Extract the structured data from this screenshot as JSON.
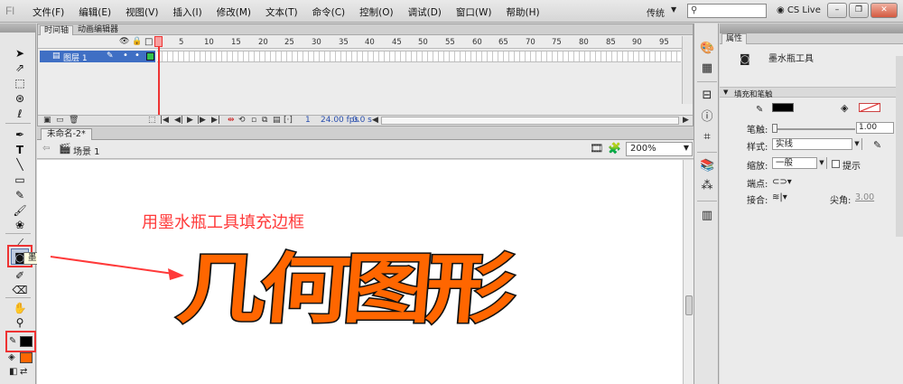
{
  "app": {
    "logo": "Fl"
  },
  "menu": [
    "文件(F)",
    "编辑(E)",
    "视图(V)",
    "插入(I)",
    "修改(M)",
    "文本(T)",
    "命令(C)",
    "控制(O)",
    "调试(D)",
    "窗口(W)",
    "帮助(H)"
  ],
  "workspace": "传统",
  "cslive": "CS Live",
  "timeline": {
    "tabs": [
      "时间轴",
      "动画编辑器"
    ],
    "frame_numbers": [
      "1",
      "5",
      "10",
      "15",
      "20",
      "25",
      "30",
      "35",
      "40",
      "45",
      "50",
      "55",
      "60",
      "65",
      "70",
      "75",
      "80",
      "85",
      "90",
      "95"
    ],
    "layer_name": "图层 1",
    "current_frame": "1",
    "fps": "24.00 fps",
    "time": "0.0 s"
  },
  "document": {
    "tab": "未命名-2*",
    "scene": "场景 1",
    "zoom": "200%"
  },
  "stage": {
    "annotation": "用墨水瓶工具填充边框",
    "shape_text": "几何图形",
    "shape_fill": "#ff6600",
    "shape_stroke": "#111111",
    "annotation_color": "#ff3a3a"
  },
  "tooltip": "墨水瓶工具(S)",
  "properties": {
    "tab": "属性",
    "tool_name": "墨水瓶工具",
    "section": "填充和笔触",
    "stroke_label": "笔触:",
    "stroke_value": "1.00",
    "style_label": "样式:",
    "style_value": "实线",
    "scale_label": "缩放:",
    "scale_value": "一般",
    "hint_label": "提示",
    "cap_label": "端点:",
    "join_label": "接合:",
    "miter_label": "尖角:",
    "miter_value": "3.00",
    "stroke_color": "#000000",
    "fill_color": "#ff6600"
  },
  "tools_colors": {
    "stroke": "#000000",
    "fill": "#ff6600"
  }
}
